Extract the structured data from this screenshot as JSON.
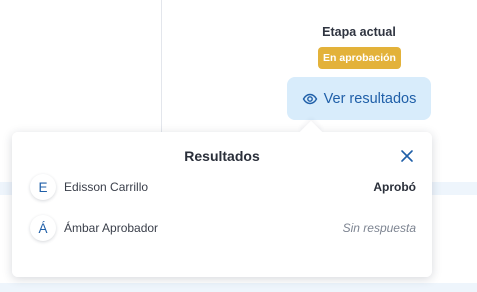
{
  "stage": {
    "title": "Etapa actual",
    "badge": "En aprobación",
    "badge_color": "#e3b23a"
  },
  "view_button": {
    "icon": "eye-icon",
    "label": "Ver resultados"
  },
  "results_popover": {
    "title": "Resultados",
    "close_icon": "close-icon",
    "rows": [
      {
        "initial": "E",
        "name": "Edisson Carrillo",
        "status": "Aprobó"
      },
      {
        "initial": "Á",
        "name": "Ámbar Aprobador",
        "status": "Sin respuesta"
      }
    ]
  },
  "colors": {
    "accent": "#1f5fa8",
    "button_bg": "#d8ecfb"
  }
}
